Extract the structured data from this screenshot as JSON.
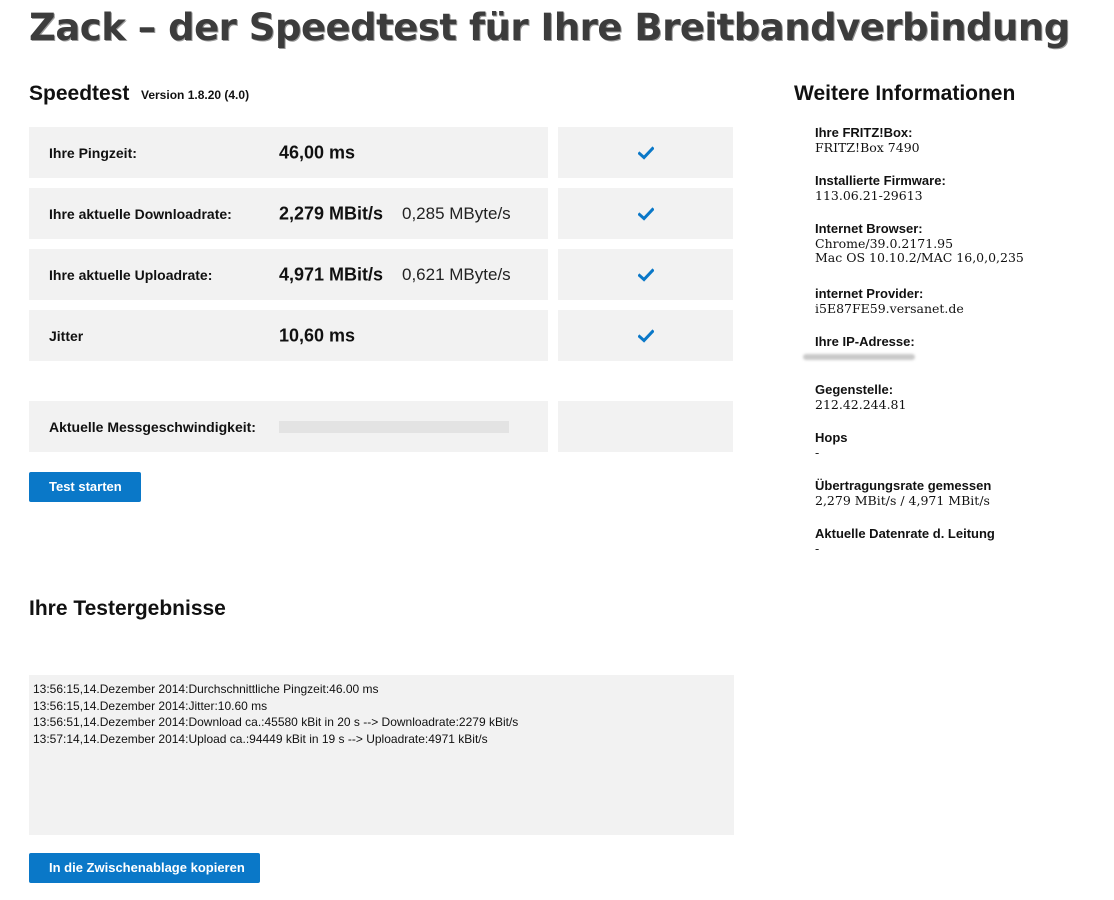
{
  "header": {
    "title": "Zack – der Speedtest für Ihre Breitbandverbindung"
  },
  "speedtest": {
    "title": "Speedtest",
    "version": "Version 1.8.20 (4.0)",
    "rows": [
      {
        "label": "Ihre Pingzeit:",
        "value": "46,00 ms",
        "value2": "",
        "status": "check-icon"
      },
      {
        "label": "Ihre aktuelle Downloadrate:",
        "value": "2,279 MBit/s",
        "value2": "0,285 MByte/s",
        "status": "check-icon"
      },
      {
        "label": "Ihre aktuelle Uploadrate:",
        "value": "4,971 MBit/s",
        "value2": "0,621 MByte/s",
        "status": "check-icon"
      },
      {
        "label": "Jitter",
        "value": "10,60 ms",
        "value2": "",
        "status": "check-icon"
      }
    ],
    "current_speed": {
      "label": "Aktuelle Messgeschwindigkeit:",
      "progress": 0
    },
    "start_button": "Test starten",
    "accent_color": "#0a78c8"
  },
  "results": {
    "title": "Ihre Testergebnisse",
    "log": [
      "13:56:15,14.Dezember 2014:Durchschnittliche Pingzeit:46.00 ms",
      "13:56:15,14.Dezember 2014:Jitter:10.60 ms",
      "13:56:51,14.Dezember 2014:Download ca.:45580 kBit in 20 s --> Downloadrate:2279 kBit/s",
      "13:57:14,14.Dezember 2014:Upload ca.:94449 kBit in 19 s --> Uploadrate:4971 kBit/s"
    ],
    "copy_button": "In die Zwischenablage kopieren"
  },
  "info": {
    "title": "Weitere Informationen",
    "fritzbox_label": "Ihre FRITZ!Box:",
    "fritzbox_value": "FRITZ!Box 7490",
    "firmware_label": "Installierte Firmware:",
    "firmware_value": "113.06.21-29613",
    "browser_label": "Internet Browser:",
    "browser_value1": "Chrome/39.0.2171.95",
    "browser_value2": "Mac OS 10.10.2/MAC 16,0,0,235",
    "provider_label": "internet Provider:",
    "provider_value": "i5E87FE59.versanet.de",
    "ip_label": "Ihre IP-Adresse:",
    "remote_label": "Gegenstelle:",
    "remote_value": "212.42.244.81",
    "hops_label": "Hops",
    "hops_value": "-",
    "rate_label": "Übertragungsrate gemessen",
    "rate_value": "2,279 MBit/s / 4,971 MBit/s",
    "line_label": "Aktuelle Datenrate d. Leitung",
    "line_value": "-"
  }
}
